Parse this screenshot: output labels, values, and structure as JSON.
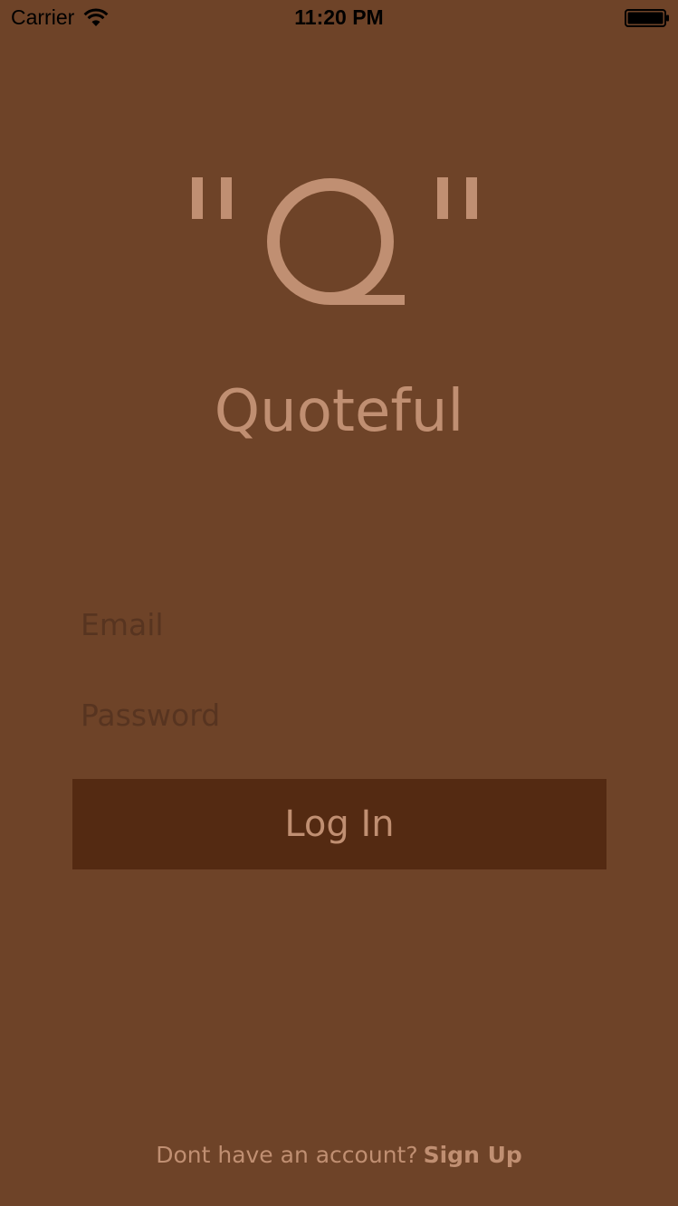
{
  "status_bar": {
    "carrier": "Carrier",
    "time": "11:20 PM",
    "wifi_icon": "wifi-icon",
    "battery_icon": "battery-icon"
  },
  "logo": {
    "glyph": "Q",
    "quote_marks": "\""
  },
  "app": {
    "name": "Quoteful"
  },
  "form": {
    "email_placeholder": "Email",
    "email_value": "",
    "password_placeholder": "Password",
    "password_value": "",
    "login_label": "Log In"
  },
  "footer": {
    "prompt": "Dont have an account?",
    "signup_label": "Sign Up"
  },
  "colors": {
    "background": "#6e4328",
    "accent": "#c08f72",
    "button": "#542a12",
    "placeholder": "#573420"
  }
}
